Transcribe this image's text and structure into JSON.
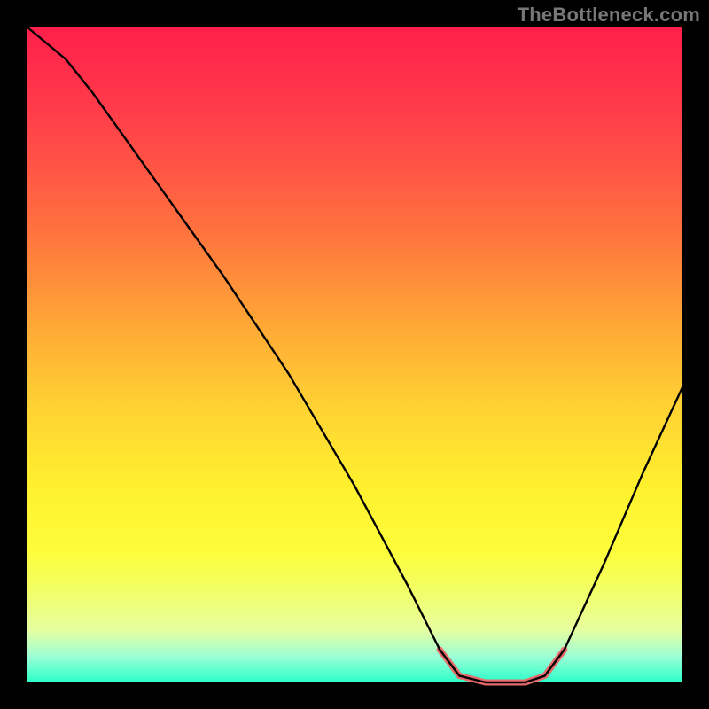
{
  "watermark": "TheBottleneck.com",
  "chart_data": {
    "type": "line",
    "title": "",
    "xlabel": "",
    "ylabel": "",
    "xlim": [
      0,
      100
    ],
    "ylim": [
      0,
      100
    ],
    "grid": false,
    "legend": false,
    "gradient": {
      "direction": "vertical",
      "stops": [
        {
          "pct": 0,
          "color": "#ff1f4a"
        },
        {
          "pct": 12,
          "color": "#ff3a4a"
        },
        {
          "pct": 30,
          "color": "#ff6e3f"
        },
        {
          "pct": 45,
          "color": "#ffa636"
        },
        {
          "pct": 58,
          "color": "#ffd233"
        },
        {
          "pct": 70,
          "color": "#fff02e"
        },
        {
          "pct": 80,
          "color": "#fdfd3a"
        },
        {
          "pct": 86,
          "color": "#f2ff66"
        },
        {
          "pct": 92,
          "color": "#e6ffa0"
        },
        {
          "pct": 96,
          "color": "#9cffd6"
        },
        {
          "pct": 100,
          "color": "#2bffc9"
        }
      ]
    },
    "series": [
      {
        "name": "main-curve",
        "color": "#000000",
        "width": 2.4,
        "points": [
          {
            "x": 0,
            "y": 100
          },
          {
            "x": 6,
            "y": 95
          },
          {
            "x": 10,
            "y": 90
          },
          {
            "x": 20,
            "y": 76
          },
          {
            "x": 30,
            "y": 62
          },
          {
            "x": 40,
            "y": 47
          },
          {
            "x": 50,
            "y": 30
          },
          {
            "x": 58,
            "y": 15
          },
          {
            "x": 63,
            "y": 5
          },
          {
            "x": 66,
            "y": 1
          },
          {
            "x": 70,
            "y": 0
          },
          {
            "x": 76,
            "y": 0
          },
          {
            "x": 79,
            "y": 1
          },
          {
            "x": 82,
            "y": 5
          },
          {
            "x": 88,
            "y": 18
          },
          {
            "x": 94,
            "y": 32
          },
          {
            "x": 100,
            "y": 45
          }
        ]
      },
      {
        "name": "flat-highlight",
        "color": "#e86a6a",
        "width": 7,
        "points": [
          {
            "x": 63,
            "y": 5
          },
          {
            "x": 66,
            "y": 1
          },
          {
            "x": 70,
            "y": 0
          },
          {
            "x": 76,
            "y": 0
          },
          {
            "x": 79,
            "y": 1
          },
          {
            "x": 82,
            "y": 5
          }
        ]
      }
    ]
  }
}
